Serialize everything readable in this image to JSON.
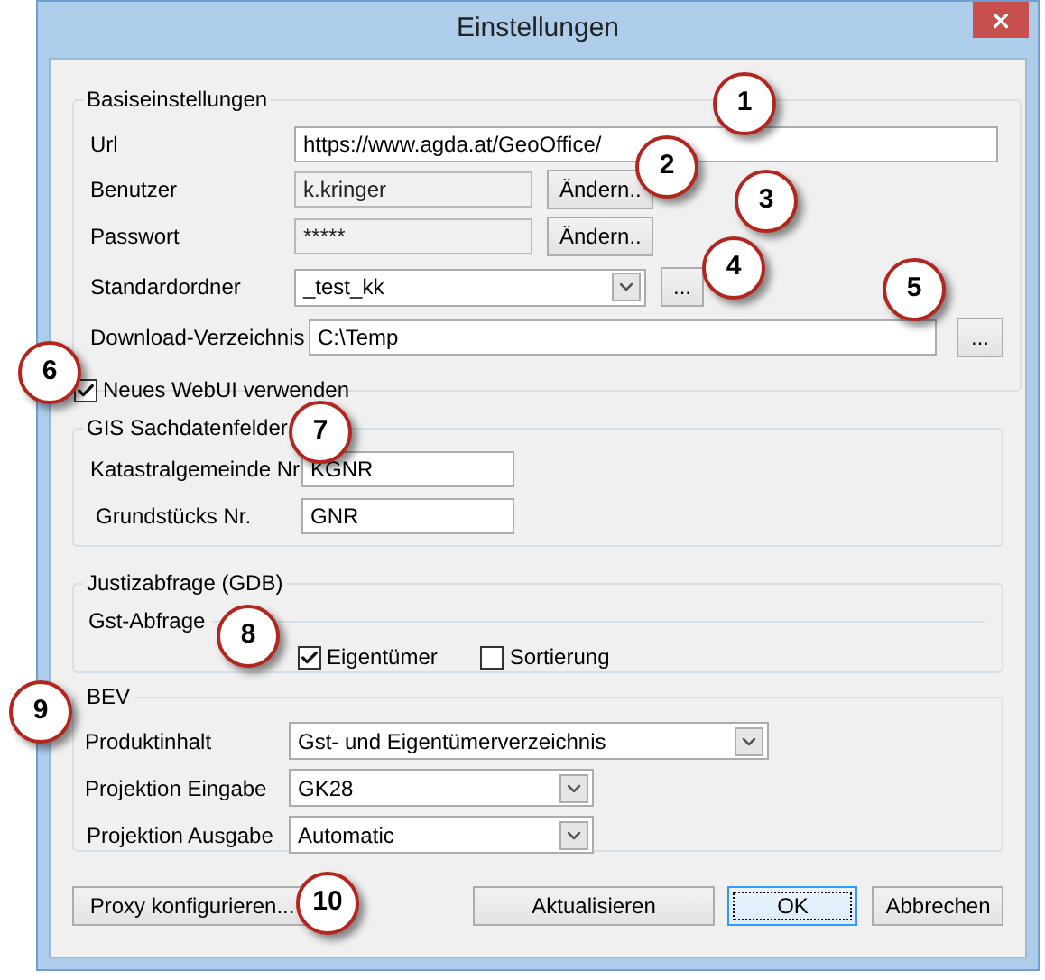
{
  "window": {
    "title": "Einstellungen"
  },
  "basis": {
    "title": "Basiseinstellungen",
    "url": {
      "label": "Url",
      "value": "https://www.agda.at/GeoOffice/"
    },
    "user": {
      "label": "Benutzer",
      "value": "k.kringer",
      "button": "Ändern.."
    },
    "password": {
      "label": "Passwort",
      "value": "*****",
      "button": "Ändern.."
    },
    "folder": {
      "label": "Standardordner",
      "value": "_test_kk",
      "button": "..."
    },
    "download": {
      "label": "Download-Verzeichnis",
      "value": "C:\\Temp",
      "button": "..."
    },
    "webui": {
      "label": "Neues WebUI verwenden",
      "checked": true
    }
  },
  "gis": {
    "title": "GIS Sachdatenfelder",
    "fields": [
      {
        "label": "Katastralgemeinde Nr.",
        "value": "KGNR"
      },
      {
        "label": "Grundstücks Nr.",
        "value": "GNR"
      }
    ]
  },
  "justiz": {
    "title": "Justizabfrage (GDB)",
    "subtitle": "Gst-Abfrage",
    "options": [
      {
        "label": "Eigentümer",
        "checked": true
      },
      {
        "label": "Sortierung",
        "checked": false
      }
    ]
  },
  "bev": {
    "title": "BEV",
    "fields": [
      {
        "label": "Produktinhalt",
        "value": "Gst- und Eigentümerverzeichnis"
      },
      {
        "label": "Projektion Eingabe",
        "value": "GK28"
      },
      {
        "label": "Projektion Ausgabe",
        "value": "Automatic"
      }
    ]
  },
  "buttons": [
    {
      "label": "Proxy konfigurieren...",
      "kind": "secondary"
    },
    {
      "label": "Aktualisieren",
      "kind": "secondary"
    },
    {
      "label": "OK",
      "kind": "default"
    },
    {
      "label": "Abbrechen",
      "kind": "secondary"
    }
  ],
  "callouts": [
    {
      "label": "1"
    },
    {
      "label": "2"
    },
    {
      "label": "3"
    },
    {
      "label": "4"
    },
    {
      "label": "5"
    },
    {
      "label": "6"
    },
    {
      "label": "7"
    },
    {
      "label": "8"
    },
    {
      "label": "9"
    },
    {
      "label": "10"
    }
  ]
}
